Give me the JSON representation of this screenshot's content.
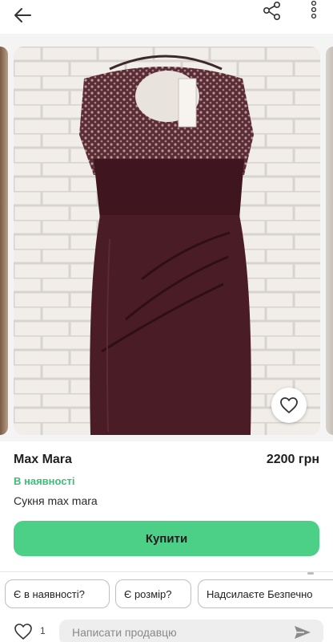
{
  "header": {
    "back_icon": "arrow-left-icon",
    "share_icon": "share-icon",
    "more_icon": "more-vertical-icon"
  },
  "gallery": {
    "like_icon": "heart-outline-icon"
  },
  "product": {
    "brand": "Max Mara",
    "price": "2200 грн",
    "availability": "В наявності",
    "description": "Сукня max mara",
    "buy_label": "Купити"
  },
  "quick_questions": [
    "Є в наявності?",
    "Є розмір?",
    "Надсилаєте Безпечно"
  ],
  "message_bar": {
    "likes_count": "1",
    "placeholder": "Написати продавцю",
    "send_icon": "send-icon"
  },
  "colors": {
    "accent_green": "#4ccf86",
    "stock_green": "#3fbd78",
    "dress": "#4a1c26"
  }
}
